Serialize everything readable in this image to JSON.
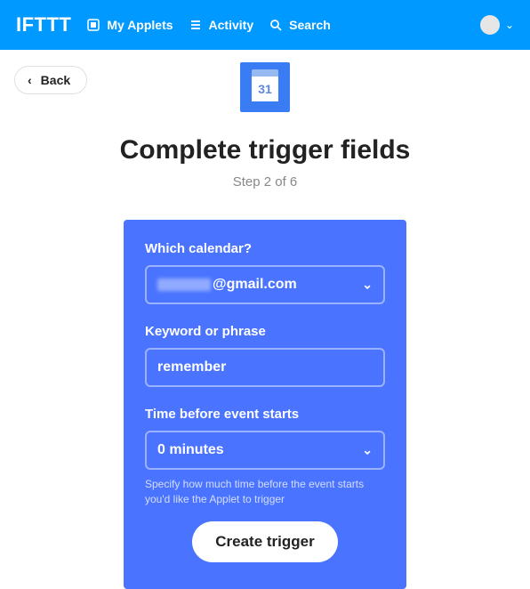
{
  "nav": {
    "logo": "IFTTT",
    "items": [
      {
        "label": "My Applets",
        "icon": "applet-icon"
      },
      {
        "label": "Activity",
        "icon": "list-icon"
      },
      {
        "label": "Search",
        "icon": "search-icon"
      }
    ]
  },
  "back": {
    "label": "Back"
  },
  "service_tile": {
    "day": "31"
  },
  "title": "Complete trigger fields",
  "subtitle": "Step 2 of 6",
  "form": {
    "calendar": {
      "label": "Which calendar?",
      "selected_suffix": "@gmail.com"
    },
    "keyword": {
      "label": "Keyword or phrase",
      "value": "remember"
    },
    "time_before": {
      "label": "Time before event starts",
      "selected": "0 minutes",
      "help": "Specify how much time before the event starts you'd like the Applet to trigger"
    },
    "submit_label": "Create trigger"
  }
}
